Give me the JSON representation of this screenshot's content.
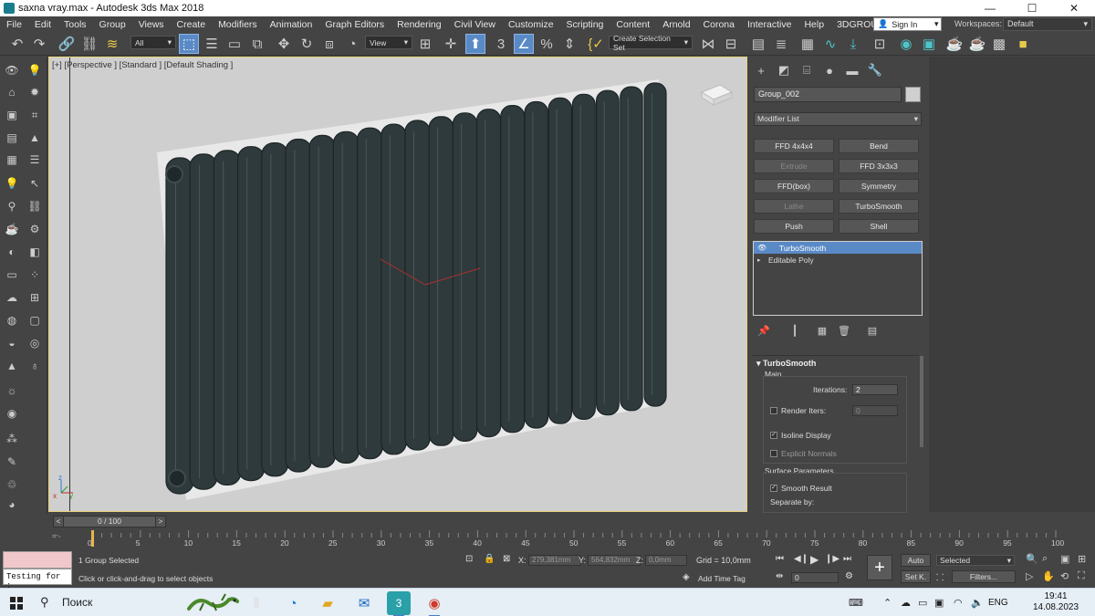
{
  "window": {
    "title": "saxna vray.max - Autodesk 3ds Max 2018",
    "minimize": "—",
    "maximize": "☐",
    "close": "✕"
  },
  "menu": [
    "File",
    "Edit",
    "Tools",
    "Group",
    "Views",
    "Create",
    "Modifiers",
    "Animation",
    "Graph Editors",
    "Rendering",
    "Civil View",
    "Customize",
    "Scripting",
    "Content",
    "Arnold",
    "Corona",
    "Interactive",
    "Help",
    "3DGROUND"
  ],
  "account": {
    "sign_in": "Sign In",
    "workspaces_label": "Workspaces:",
    "workspace_value": "Default"
  },
  "toolbar": {
    "selection_filter": "All",
    "reference_coord": "View",
    "named_selection": "Create Selection Set"
  },
  "viewport": {
    "label": "[+] [Perspective ] [Standard ] [Default Shading ]"
  },
  "command_panel": {
    "object_name": "Group_002",
    "modifier_list": "Modifier List",
    "modifier_buttons": [
      {
        "label": "FFD 4x4x4",
        "enabled": true
      },
      {
        "label": "Bend",
        "enabled": true
      },
      {
        "label": "Extrude",
        "enabled": false
      },
      {
        "label": "FFD 3x3x3",
        "enabled": true
      },
      {
        "label": "FFD(box)",
        "enabled": true
      },
      {
        "label": "Symmetry",
        "enabled": true
      },
      {
        "label": "Lathe",
        "enabled": false
      },
      {
        "label": "TurboSmooth",
        "enabled": true
      },
      {
        "label": "Push",
        "enabled": true
      },
      {
        "label": "Shell",
        "enabled": true
      }
    ],
    "stack": [
      {
        "label": "TurboSmooth",
        "selected": true
      },
      {
        "label": "Editable Poly",
        "selected": false
      }
    ],
    "rollout": {
      "title": "TurboSmooth",
      "main_group": "Main",
      "iterations_label": "Iterations:",
      "iterations_value": "2",
      "render_iters_label": "Render Iters:",
      "render_iters_value": "0",
      "isoline_display": "Isoline Display",
      "isoline_checked": true,
      "explicit_normals": "Explicit Normals",
      "explicit_checked": false,
      "render_iters_checked": false,
      "surface_group": "Surface Parameters",
      "smooth_result": "Smooth Result",
      "smooth_checked": true,
      "separate_by": "Separate by:"
    }
  },
  "time_slider": {
    "frame_display": "0 / 100",
    "prev": "<",
    "next": ">"
  },
  "track_bar": {
    "ticks": [
      "0",
      "5",
      "10",
      "15",
      "20",
      "25",
      "30",
      "35",
      "40",
      "45",
      "50",
      "55",
      "60",
      "65",
      "70",
      "75",
      "80",
      "85",
      "90",
      "95",
      "100"
    ]
  },
  "status": {
    "maxscript_input": "Testing for :",
    "selection_info": "1 Group Selected",
    "prompt": "Click or click-and-drag to select objects",
    "x_label": "X:",
    "x_value": "279,381mm",
    "y_label": "Y:",
    "y_value": "564,832mm",
    "z_label": "Z:",
    "z_value": "0,0mm",
    "grid": "Grid = 10,0mm",
    "add_time_tag": "Add Time Tag",
    "current_frame": "0",
    "auto_key": "Auto",
    "set_key": "Set K.",
    "key_mode": "Selected",
    "filters": "Filters..."
  },
  "taskbar": {
    "search": "Поиск",
    "language": "ENG",
    "time": "19:41",
    "date": "14.08.2023"
  },
  "colors": {
    "viewport_bg": "#cfcfcf",
    "radiator": "#2f3a3c",
    "selection_highlight": "#5a8ac6"
  }
}
